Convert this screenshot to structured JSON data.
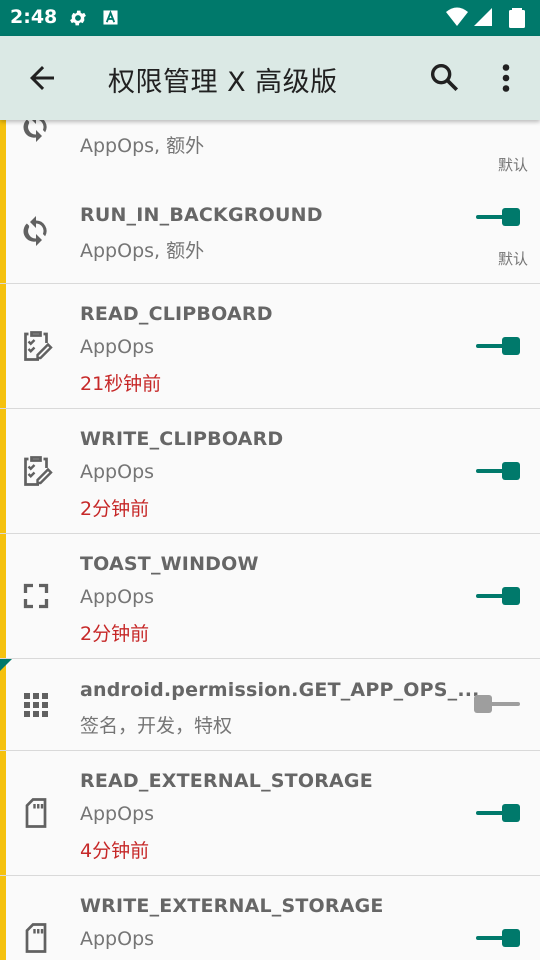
{
  "status_bar": {
    "time": "2:48",
    "background": "#00796b"
  },
  "app_bar": {
    "title": "权限管理 X 高级版",
    "icons": [
      "arrow-back-icon",
      "search-icon",
      "more-vert-icon"
    ]
  },
  "colors": {
    "accent": "#00796b",
    "stripe": "#f5c10e",
    "time_text": "#c62828"
  },
  "permissions": [
    {
      "name": "",
      "sub": "AppOps, 额外",
      "time": "",
      "default_label": "默认",
      "enabled": true,
      "icon": "sync-icon"
    },
    {
      "name": "RUN_IN_BACKGROUND",
      "sub": "AppOps, 额外",
      "time": "",
      "default_label": "默认",
      "enabled": true,
      "icon": "sync-icon"
    },
    {
      "name": "READ_CLIPBOARD",
      "sub": "AppOps",
      "time": "21秒钟前",
      "enabled": true,
      "icon": "clipboard-edit-icon"
    },
    {
      "name": "WRITE_CLIPBOARD",
      "sub": "AppOps",
      "time": "2分钟前",
      "enabled": true,
      "icon": "clipboard-edit-icon"
    },
    {
      "name": "TOAST_WINDOW",
      "sub": "AppOps",
      "time": "2分钟前",
      "enabled": true,
      "icon": "fullscreen-icon"
    },
    {
      "name": "android.permission.GET_APP_OPS_...",
      "sub": "签名，开发，特权",
      "time": "",
      "enabled": false,
      "icon": "apps-grid-icon"
    },
    {
      "name": "READ_EXTERNAL_STORAGE",
      "sub": "AppOps",
      "time": "4分钟前",
      "enabled": true,
      "icon": "sd-card-icon"
    },
    {
      "name": "WRITE_EXTERNAL_STORAGE",
      "sub": "AppOps",
      "time": "",
      "enabled": true,
      "icon": "sd-card-icon"
    }
  ]
}
